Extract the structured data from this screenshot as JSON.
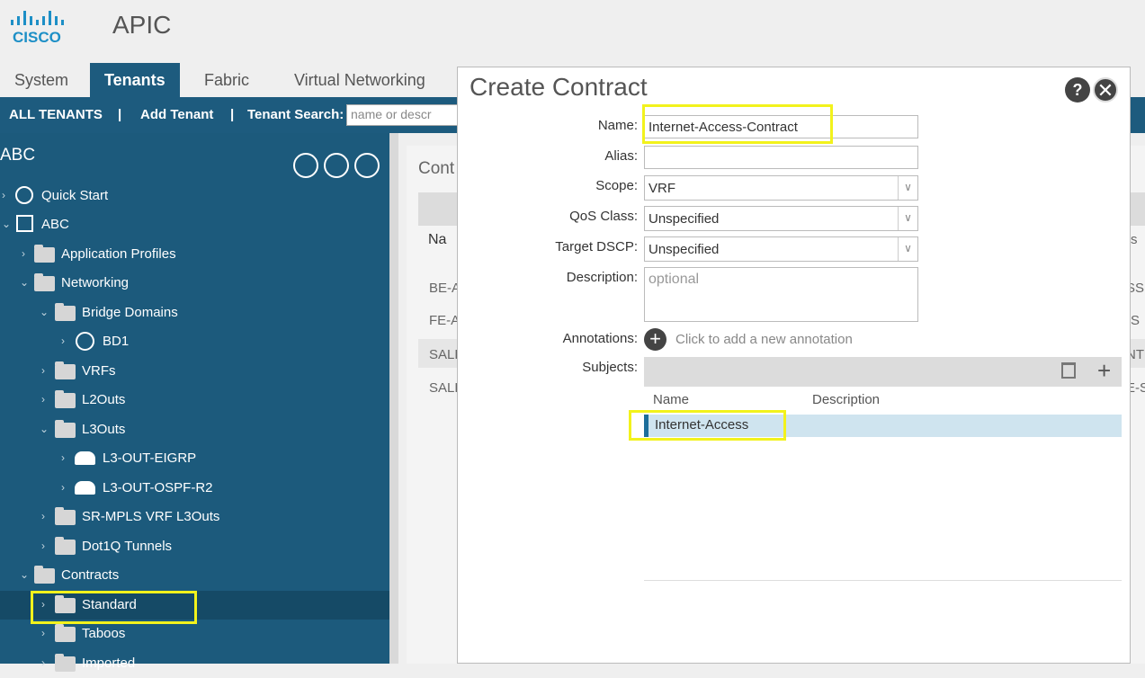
{
  "app": {
    "title": "APIC",
    "logo_text": "CISCO"
  },
  "tabs": [
    "System",
    "Tenants",
    "Fabric",
    "Virtual Networking"
  ],
  "subbar": {
    "all_tenants": "ALL TENANTS",
    "sep": "|",
    "add_tenant": "Add Tenant",
    "search_label": "Tenant Search:",
    "search_placeholder": "name or descr"
  },
  "sidebar": {
    "title": "ABC",
    "items": [
      {
        "label": "Quick Start"
      },
      {
        "label": "ABC"
      },
      {
        "label": "Application Profiles"
      },
      {
        "label": "Networking"
      },
      {
        "label": "Bridge Domains"
      },
      {
        "label": "BD1"
      },
      {
        "label": "VRFs"
      },
      {
        "label": "L2Outs"
      },
      {
        "label": "L3Outs"
      },
      {
        "label": "L3-OUT-EIGRP"
      },
      {
        "label": "L3-OUT-OSPF-R2"
      },
      {
        "label": "SR-MPLS VRF L3Outs"
      },
      {
        "label": "Dot1Q Tunnels"
      },
      {
        "label": "Contracts"
      },
      {
        "label": "Standard"
      },
      {
        "label": "Taboos"
      },
      {
        "label": "Imported"
      }
    ]
  },
  "background_panel": {
    "heading": "Cont",
    "col": "Na",
    "rows": [
      "BE-A",
      "FE-A",
      "SALE",
      "SALE"
    ],
    "right_texts": [
      "s",
      "SS",
      "S",
      "NTI",
      "E-S"
    ]
  },
  "dialog": {
    "title": "Create Contract",
    "help": "?",
    "close": "✕",
    "fields": {
      "name_label": "Name:",
      "name_value": "Internet-Access-Contract",
      "alias_label": "Alias:",
      "alias_value": "",
      "scope_label": "Scope:",
      "scope_value": "VRF",
      "qos_label": "QoS Class:",
      "qos_value": "Unspecified",
      "dscp_label": "Target DSCP:",
      "dscp_value": "Unspecified",
      "desc_label": "Description:",
      "desc_placeholder": "optional",
      "annotations_label": "Annotations:",
      "annotations_hint": "Click to add a new annotation",
      "subjects_label": "Subjects:"
    },
    "subjects_table": {
      "col_name": "Name",
      "col_description": "Description",
      "rows": [
        {
          "name": "Internet-Access",
          "description": ""
        }
      ]
    }
  },
  "colors": {
    "brand_blue": "#1d5b7e",
    "sidebar": "#1c5a7c",
    "highlight": "#f2f21c"
  }
}
